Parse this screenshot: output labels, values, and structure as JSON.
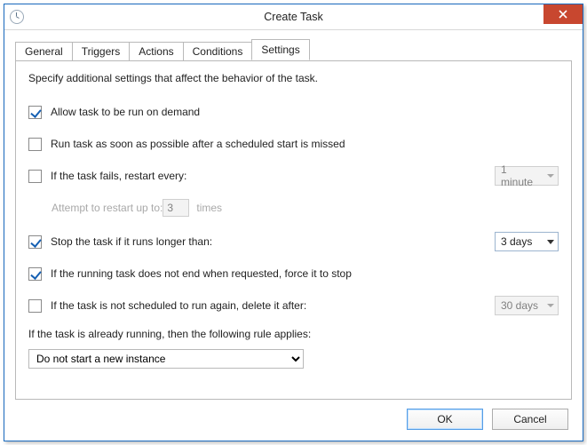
{
  "window": {
    "title": "Create Task",
    "close_tooltip": "Close"
  },
  "tabs": {
    "general": "General",
    "triggers": "Triggers",
    "actions": "Actions",
    "conditions": "Conditions",
    "settings": "Settings"
  },
  "settings": {
    "intro": "Specify additional settings that affect the behavior of the task.",
    "allow_on_demand": {
      "checked": true,
      "label": "Allow task to be run on demand"
    },
    "run_asap_missed": {
      "checked": false,
      "label": "Run task as soon as possible after a scheduled start is missed"
    },
    "restart_on_fail": {
      "checked": false,
      "label": "If the task fails, restart every:",
      "interval": "1 minute",
      "attempt_label": "Attempt to restart up to:",
      "attempt_count": "3",
      "attempt_suffix": "times"
    },
    "stop_if_longer": {
      "checked": true,
      "label": "Stop the task if it runs longer than:",
      "value": "3 days"
    },
    "force_stop": {
      "checked": true,
      "label": "If the running task does not end when requested, force it to stop"
    },
    "delete_after": {
      "checked": false,
      "label": "If the task is not scheduled to run again, delete it after:",
      "value": "30 days"
    },
    "rule": {
      "label": "If the task is already running, then the following rule applies:",
      "value": "Do not start a new instance"
    }
  },
  "buttons": {
    "ok": "OK",
    "cancel": "Cancel"
  }
}
